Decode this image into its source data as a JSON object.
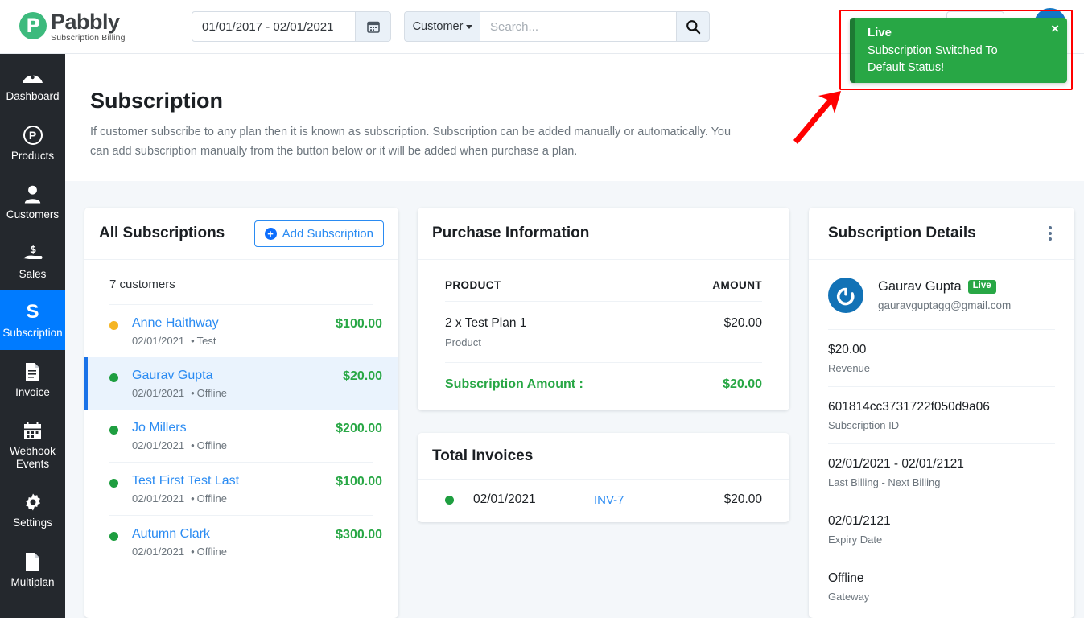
{
  "brand": {
    "name": "Pabbly",
    "tagline": "Subscription Billing",
    "mark_letter": "P",
    "accent": "#3dba7d"
  },
  "topbar": {
    "date_range_value": "01/01/2017 - 02/01/2021",
    "calendar_icon": "calendar-icon",
    "search_category": "Customer",
    "search_placeholder": "Search...",
    "search_value": "",
    "search_icon": "magnifier-icon"
  },
  "sidebar": {
    "items": [
      {
        "label": "Dashboard",
        "icon": "gauge-icon",
        "active": false
      },
      {
        "label": "Products",
        "icon": "p-circle-icon",
        "active": false
      },
      {
        "label": "Customers",
        "icon": "person-icon",
        "active": false
      },
      {
        "label": "Sales",
        "icon": "hand-dollar-icon",
        "active": false
      },
      {
        "label": "Subscription",
        "icon": "s-letter-icon",
        "active": true
      },
      {
        "label": "Invoice",
        "icon": "document-lines-icon",
        "active": false
      },
      {
        "label": "Webhook Events",
        "icon": "calendar-grid-icon",
        "active": false
      },
      {
        "label": "Settings",
        "icon": "gear-icon",
        "active": false
      },
      {
        "label": "Multiplan",
        "icon": "page-icon",
        "active": false
      }
    ],
    "active_color": "#007bff",
    "background": "#24282d"
  },
  "page": {
    "title": "Subscription",
    "description": "If customer subscribe to any plan then it is known as subscription. Subscription can be added manually or automatically. You can add subscription manually from the button below or it will be added when purchase a plan."
  },
  "all_subscriptions": {
    "title": "All Subscriptions",
    "add_button": "Add Subscription",
    "add_icon": "plus-circle-icon",
    "count_text": "7 customers",
    "items": [
      {
        "name": "Anne Haithway",
        "date": "02/01/2021",
        "gateway": "Test",
        "amount": "$100.00",
        "status_color": "#f5b523",
        "selected": false
      },
      {
        "name": "Gaurav Gupta",
        "date": "02/01/2021",
        "gateway": "Offline",
        "amount": "$20.00",
        "status_color": "#1e9e40",
        "selected": true
      },
      {
        "name": "Jo Millers",
        "date": "02/01/2021",
        "gateway": "Offline",
        "amount": "$200.00",
        "status_color": "#1e9e40",
        "selected": false
      },
      {
        "name": "Test First Test Last",
        "date": "02/01/2021",
        "gateway": "Offline",
        "amount": "$100.00",
        "status_color": "#1e9e40",
        "selected": false
      },
      {
        "name": "Autumn Clark",
        "date": "02/01/2021",
        "gateway": "Offline",
        "amount": "$300.00",
        "status_color": "#1e9e40",
        "selected": false
      }
    ]
  },
  "purchase_information": {
    "title": "Purchase Information",
    "col_product": "PRODUCT",
    "col_amount": "AMOUNT",
    "rows": [
      {
        "product": "2 x Test Plan 1",
        "type": "Product",
        "amount": "$20.00"
      }
    ],
    "total_label": "Subscription Amount :",
    "total_amount": "$20.00"
  },
  "total_invoices": {
    "title": "Total Invoices",
    "rows": [
      {
        "date": "02/01/2021",
        "invoice_no": "INV-7",
        "amount": "$20.00",
        "status_color": "#1e9e40"
      }
    ]
  },
  "subscription_details": {
    "title": "Subscription Details",
    "menu_icon": "kebab-menu-icon",
    "avatar_icon": "power-avatar-icon",
    "customer_name": "Gaurav Gupta",
    "status_badge": "Live",
    "email": "gauravguptagg@gmail.com",
    "fields": [
      {
        "value": "$20.00",
        "label": "Revenue"
      },
      {
        "value": "601814cc3731722f050d9a06",
        "label": "Subscription ID"
      },
      {
        "value": "02/01/2021 - 02/01/2121",
        "label": "Last Billing - Next Billing"
      },
      {
        "value": "02/01/2121",
        "label": "Expiry Date"
      },
      {
        "value": "Offline",
        "label": "Gateway"
      }
    ]
  },
  "toast": {
    "title": "Live",
    "message": "Subscription Switched To Default Status!",
    "close_label": "×",
    "background": "#28a745"
  },
  "annotation": {
    "highlight_color": "#ff0000",
    "arrow_icon": "arrow-up-right-icon"
  }
}
